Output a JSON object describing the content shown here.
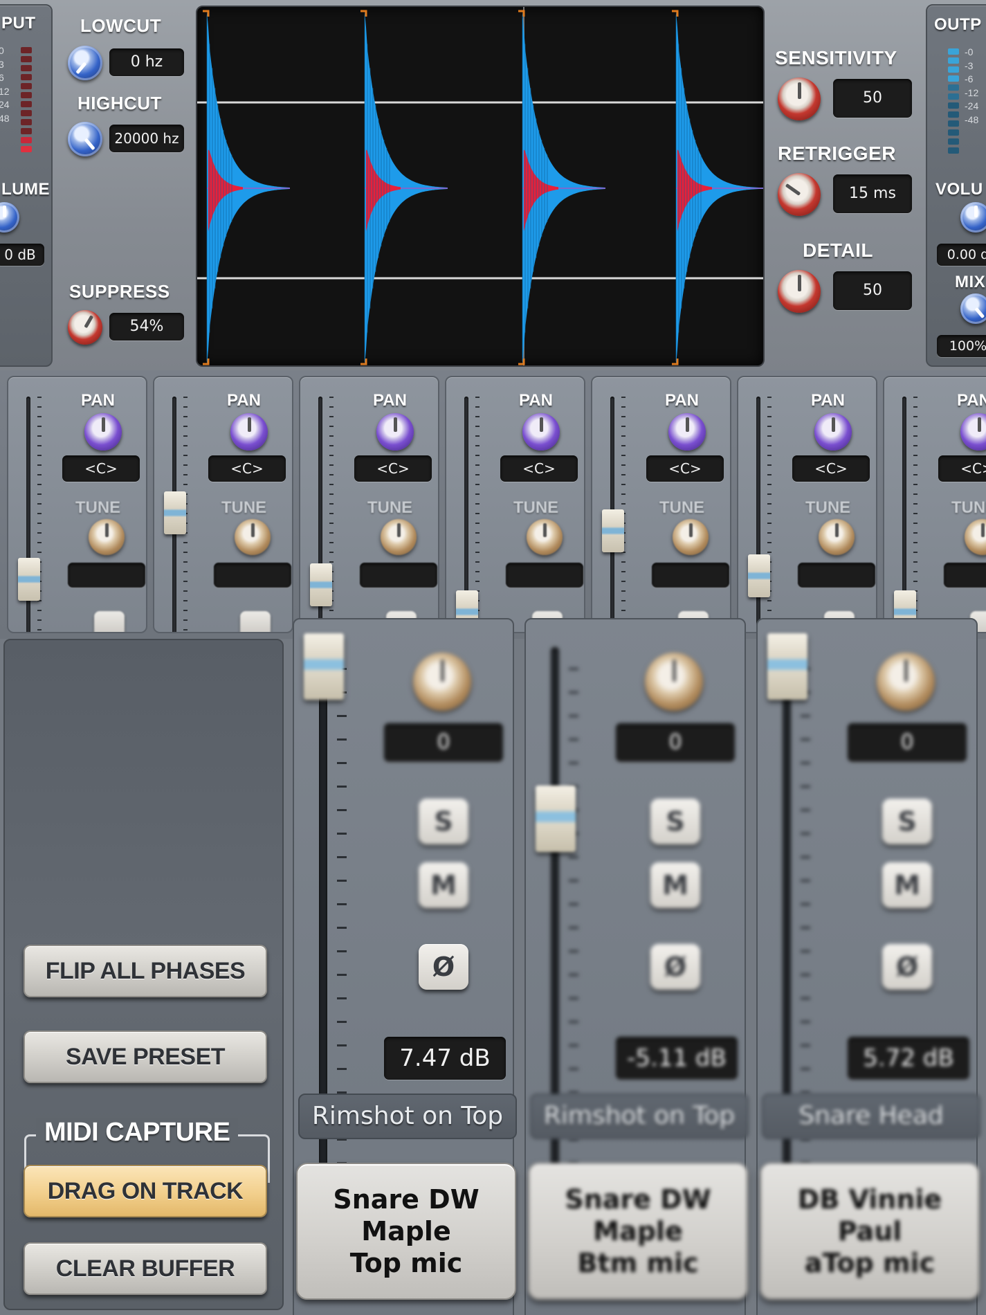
{
  "input_panel": {
    "title": "PUT",
    "meter_scale": [
      "0",
      "3",
      "6",
      "12",
      "24",
      "48"
    ],
    "volume_label": "LUME",
    "volume_value": "0 dB"
  },
  "filters": {
    "lowcut_label": "LOWCUT",
    "lowcut_value": "0 hz",
    "highcut_label": "HIGHCUT",
    "highcut_value": "20000 hz",
    "suppress_label": "SUPPRESS",
    "suppress_value": "54%"
  },
  "detection": {
    "sensitivity_label": "SENSITIVITY",
    "sensitivity_value": "50",
    "retrigger_label": "RETRIGGER",
    "retrigger_value": "15 ms",
    "detail_label": "DETAIL",
    "detail_value": "50"
  },
  "output_panel": {
    "title": "OUTP",
    "meter_scale": [
      "-0",
      "-3",
      "-6",
      "-12",
      "-24",
      "-48"
    ],
    "volume_label": "VOLU",
    "volume_value": "0.00 d",
    "mix_label": "MIX",
    "mix_value": "100%"
  },
  "strips": [
    {
      "pan_label": "PAN",
      "pan_value": "<C>",
      "tune_label": "TUNE",
      "fader_level": 0.18
    },
    {
      "pan_label": "PAN",
      "pan_value": "<C>",
      "tune_label": "TUNE",
      "fader_level": 0.55
    },
    {
      "pan_label": "PAN",
      "pan_value": "<C>",
      "tune_label": "TUNE",
      "fader_level": 0.15
    },
    {
      "pan_label": "PAN",
      "pan_value": "<C>",
      "tune_label": "TUNE",
      "fader_level": 0.0
    },
    {
      "pan_label": "PAN",
      "pan_value": "<C>",
      "tune_label": "TUNE",
      "fader_level": 0.45
    },
    {
      "pan_label": "PAN",
      "pan_value": "<C>",
      "tune_label": "TUNE",
      "fader_level": 0.2
    },
    {
      "pan_label": "PAN",
      "pan_value": "<C>",
      "tune_label": "TUNE",
      "fader_level": 0.0
    }
  ],
  "left_panel": {
    "flip_label": "FLIP ALL PHASES",
    "save_label": "SAVE PRESET",
    "midi_title": "MIDI CAPTURE",
    "drag_label": "DRAG ON TRACK",
    "clear_label": "CLEAR BUFFER"
  },
  "zoom_strips": [
    {
      "tune_value": "0",
      "solo": "S",
      "mute": "M",
      "phase": "Ø",
      "gain": "7.47 dB",
      "name": "Rimshot on Top",
      "mic_line1": "Snare DW Maple",
      "mic_line2": "Top mic"
    },
    {
      "tune_value": "0",
      "solo": "S",
      "mute": "M",
      "phase": "Ø",
      "gain": "-5.11 dB",
      "name": "Rimshot on Top",
      "mic_line1": "Snare DW Maple",
      "mic_line2": "Btm mic"
    },
    {
      "tune_value": "0",
      "solo": "S",
      "mute": "M",
      "phase": "Ø",
      "gain": "5.72 dB",
      "name": "Snare Head",
      "mic_line1": "DB Vinnie Paul",
      "mic_line2": "aTop mic"
    }
  ],
  "colors": {
    "waveform_outer": "#1e9bea",
    "waveform_inner": "#e8203a",
    "marker": "#e07a1c",
    "lcd_bg": "#1c1c1c"
  }
}
